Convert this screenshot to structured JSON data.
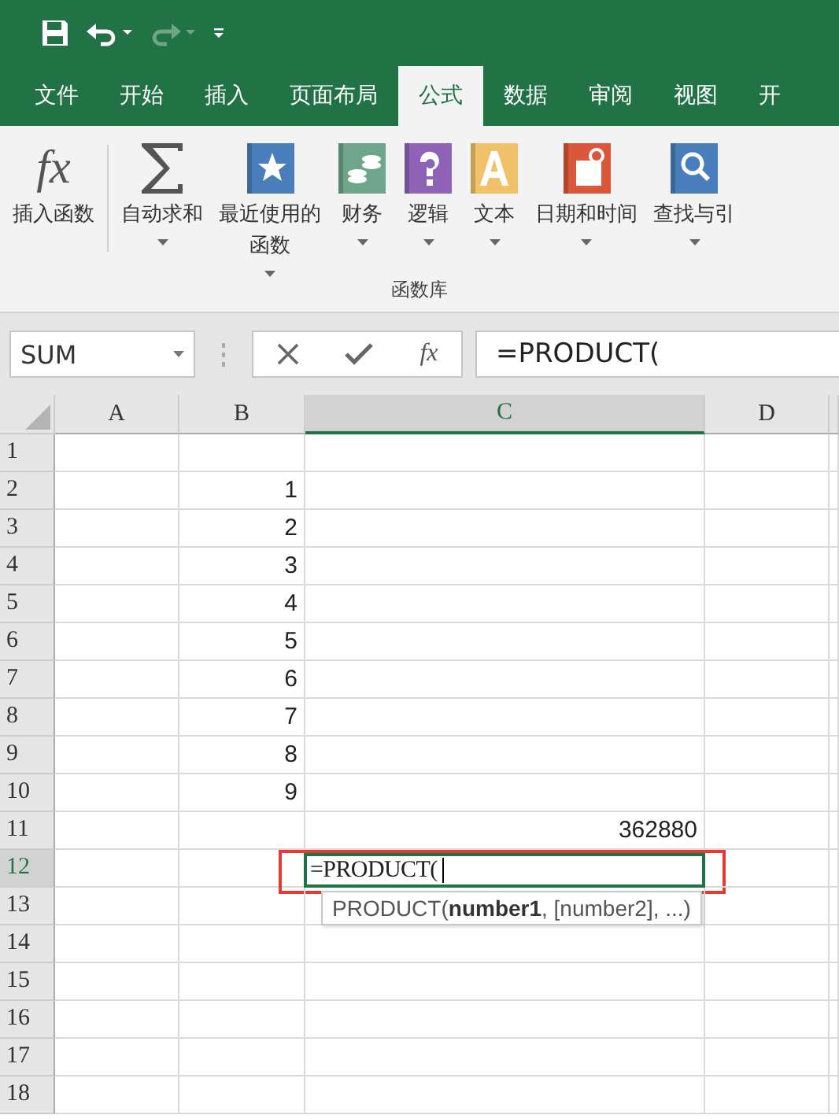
{
  "quick_access": {
    "redo_disabled": true
  },
  "tabs": [
    {
      "label": "文件",
      "selected": false
    },
    {
      "label": "开始",
      "selected": false
    },
    {
      "label": "插入",
      "selected": false
    },
    {
      "label": "页面布局",
      "selected": false
    },
    {
      "label": "公式",
      "selected": true
    },
    {
      "label": "数据",
      "selected": false
    },
    {
      "label": "审阅",
      "selected": false
    },
    {
      "label": "视图",
      "selected": false
    },
    {
      "label": "开",
      "selected": false
    }
  ],
  "ribbon": {
    "group_label": "函数库",
    "items": [
      {
        "kind": "fx",
        "glyph": "fx",
        "lines": [
          "插入函数"
        ],
        "dropdown": false
      },
      {
        "kind": "sum",
        "lines": [
          "自动求和"
        ],
        "dropdown": true
      },
      {
        "kind": "star",
        "color": "#4a7ebb",
        "lines": [
          "最近使用的",
          "函数"
        ],
        "dropdown": true
      },
      {
        "kind": "coins",
        "color": "#6fa58a",
        "lines": [
          "财务"
        ],
        "dropdown": true
      },
      {
        "kind": "question",
        "color": "#8e62b5",
        "lines": [
          "逻辑"
        ],
        "dropdown": true
      },
      {
        "kind": "letter",
        "color": "#f0c36b",
        "lines": [
          "文本"
        ],
        "dropdown": true
      },
      {
        "kind": "calendar",
        "color": "#d9573a",
        "lines": [
          "日期和时间"
        ],
        "dropdown": true
      },
      {
        "kind": "search",
        "color": "#4a7ebb",
        "lines": [
          "查找与引"
        ],
        "dropdown": true
      }
    ]
  },
  "formula_bar": {
    "name_box": "SUM",
    "fx_glyph": "fx",
    "formula": "=PRODUCT("
  },
  "columns": [
    {
      "label": "A",
      "selected": false
    },
    {
      "label": "B",
      "selected": false
    },
    {
      "label": "C",
      "selected": true
    },
    {
      "label": "D",
      "selected": false
    }
  ],
  "rows": [
    {
      "label": "1",
      "selected": false,
      "cells": [
        {
          "editing": false
        },
        {
          "editing": false
        },
        {
          "editing": false
        },
        {
          "editing": false
        }
      ]
    },
    {
      "label": "2",
      "selected": false,
      "cells": [
        {
          "editing": false
        },
        {
          "text": "1",
          "editing": false
        },
        {
          "editing": false
        },
        {
          "editing": false
        }
      ]
    },
    {
      "label": "3",
      "selected": false,
      "cells": [
        {
          "editing": false
        },
        {
          "text": "2",
          "editing": false
        },
        {
          "editing": false
        },
        {
          "editing": false
        }
      ]
    },
    {
      "label": "4",
      "selected": false,
      "cells": [
        {
          "editing": false
        },
        {
          "text": "3",
          "editing": false
        },
        {
          "editing": false
        },
        {
          "editing": false
        }
      ]
    },
    {
      "label": "5",
      "selected": false,
      "cells": [
        {
          "editing": false
        },
        {
          "text": "4",
          "editing": false
        },
        {
          "editing": false
        },
        {
          "editing": false
        }
      ]
    },
    {
      "label": "6",
      "selected": false,
      "cells": [
        {
          "editing": false
        },
        {
          "text": "5",
          "editing": false
        },
        {
          "editing": false
        },
        {
          "editing": false
        }
      ]
    },
    {
      "label": "7",
      "selected": false,
      "cells": [
        {
          "editing": false
        },
        {
          "text": "6",
          "editing": false
        },
        {
          "editing": false
        },
        {
          "editing": false
        }
      ]
    },
    {
      "label": "8",
      "selected": false,
      "cells": [
        {
          "editing": false
        },
        {
          "text": "7",
          "editing": false
        },
        {
          "editing": false
        },
        {
          "editing": false
        }
      ]
    },
    {
      "label": "9",
      "selected": false,
      "cells": [
        {
          "editing": false
        },
        {
          "text": "8",
          "editing": false
        },
        {
          "editing": false
        },
        {
          "editing": false
        }
      ]
    },
    {
      "label": "10",
      "selected": false,
      "cells": [
        {
          "editing": false
        },
        {
          "text": "9",
          "editing": false
        },
        {
          "editing": false
        },
        {
          "editing": false
        }
      ]
    },
    {
      "label": "11",
      "selected": false,
      "cells": [
        {
          "editing": false
        },
        {
          "editing": false
        },
        {
          "text": "362880",
          "editing": false
        },
        {
          "editing": false
        }
      ]
    },
    {
      "label": "12",
      "selected": true,
      "cells": [
        {
          "editing": false
        },
        {
          "editing": false
        },
        {
          "text": "=PRODUCT(",
          "editing": true,
          "highlighted": true,
          "tip": "PRODUCT(**number1**, [number2], ...)"
        },
        {
          "editing": false
        }
      ]
    },
    {
      "label": "13",
      "selected": false,
      "cells": [
        {
          "editing": false
        },
        {
          "editing": false
        },
        {
          "editing": false
        },
        {
          "editing": false
        }
      ]
    },
    {
      "label": "14",
      "selected": false,
      "cells": [
        {
          "editing": false
        },
        {
          "editing": false
        },
        {
          "editing": false
        },
        {
          "editing": false
        }
      ]
    },
    {
      "label": "15",
      "selected": false,
      "cells": [
        {
          "editing": false
        },
        {
          "editing": false
        },
        {
          "editing": false
        },
        {
          "editing": false
        }
      ]
    },
    {
      "label": "16",
      "selected": false,
      "cells": [
        {
          "editing": false
        },
        {
          "editing": false
        },
        {
          "editing": false
        },
        {
          "editing": false
        }
      ]
    },
    {
      "label": "17",
      "selected": false,
      "cells": [
        {
          "editing": false
        },
        {
          "editing": false
        },
        {
          "editing": false
        },
        {
          "editing": false
        }
      ]
    },
    {
      "label": "18",
      "selected": false,
      "cells": [
        {
          "editing": false
        },
        {
          "editing": false
        },
        {
          "editing": false
        },
        {
          "editing": false
        }
      ]
    }
  ]
}
